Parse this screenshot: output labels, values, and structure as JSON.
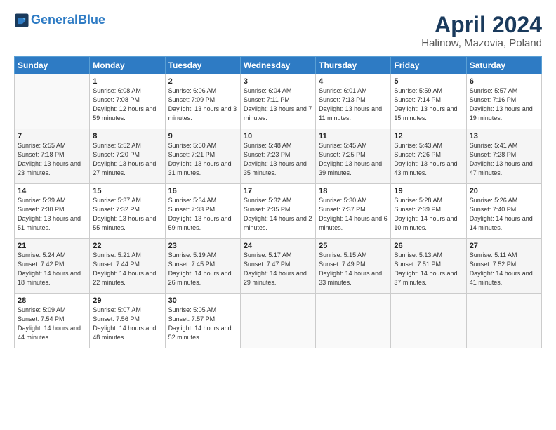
{
  "header": {
    "logo_line1": "General",
    "logo_line2": "Blue",
    "title": "April 2024",
    "subtitle": "Halinow, Mazovia, Poland"
  },
  "weekdays": [
    "Sunday",
    "Monday",
    "Tuesday",
    "Wednesday",
    "Thursday",
    "Friday",
    "Saturday"
  ],
  "weeks": [
    [
      {
        "day": "",
        "sunrise": "",
        "sunset": "",
        "daylight": "",
        "empty": true
      },
      {
        "day": "1",
        "sunrise": "6:08 AM",
        "sunset": "7:08 PM",
        "daylight": "12 hours and 59 minutes."
      },
      {
        "day": "2",
        "sunrise": "6:06 AM",
        "sunset": "7:09 PM",
        "daylight": "13 hours and 3 minutes."
      },
      {
        "day": "3",
        "sunrise": "6:04 AM",
        "sunset": "7:11 PM",
        "daylight": "13 hours and 7 minutes."
      },
      {
        "day": "4",
        "sunrise": "6:01 AM",
        "sunset": "7:13 PM",
        "daylight": "13 hours and 11 minutes."
      },
      {
        "day": "5",
        "sunrise": "5:59 AM",
        "sunset": "7:14 PM",
        "daylight": "13 hours and 15 minutes."
      },
      {
        "day": "6",
        "sunrise": "5:57 AM",
        "sunset": "7:16 PM",
        "daylight": "13 hours and 19 minutes."
      }
    ],
    [
      {
        "day": "7",
        "sunrise": "5:55 AM",
        "sunset": "7:18 PM",
        "daylight": "13 hours and 23 minutes."
      },
      {
        "day": "8",
        "sunrise": "5:52 AM",
        "sunset": "7:20 PM",
        "daylight": "13 hours and 27 minutes."
      },
      {
        "day": "9",
        "sunrise": "5:50 AM",
        "sunset": "7:21 PM",
        "daylight": "13 hours and 31 minutes."
      },
      {
        "day": "10",
        "sunrise": "5:48 AM",
        "sunset": "7:23 PM",
        "daylight": "13 hours and 35 minutes."
      },
      {
        "day": "11",
        "sunrise": "5:45 AM",
        "sunset": "7:25 PM",
        "daylight": "13 hours and 39 minutes."
      },
      {
        "day": "12",
        "sunrise": "5:43 AM",
        "sunset": "7:26 PM",
        "daylight": "13 hours and 43 minutes."
      },
      {
        "day": "13",
        "sunrise": "5:41 AM",
        "sunset": "7:28 PM",
        "daylight": "13 hours and 47 minutes."
      }
    ],
    [
      {
        "day": "14",
        "sunrise": "5:39 AM",
        "sunset": "7:30 PM",
        "daylight": "13 hours and 51 minutes."
      },
      {
        "day": "15",
        "sunrise": "5:37 AM",
        "sunset": "7:32 PM",
        "daylight": "13 hours and 55 minutes."
      },
      {
        "day": "16",
        "sunrise": "5:34 AM",
        "sunset": "7:33 PM",
        "daylight": "13 hours and 59 minutes."
      },
      {
        "day": "17",
        "sunrise": "5:32 AM",
        "sunset": "7:35 PM",
        "daylight": "14 hours and 2 minutes."
      },
      {
        "day": "18",
        "sunrise": "5:30 AM",
        "sunset": "7:37 PM",
        "daylight": "14 hours and 6 minutes."
      },
      {
        "day": "19",
        "sunrise": "5:28 AM",
        "sunset": "7:39 PM",
        "daylight": "14 hours and 10 minutes."
      },
      {
        "day": "20",
        "sunrise": "5:26 AM",
        "sunset": "7:40 PM",
        "daylight": "14 hours and 14 minutes."
      }
    ],
    [
      {
        "day": "21",
        "sunrise": "5:24 AM",
        "sunset": "7:42 PM",
        "daylight": "14 hours and 18 minutes."
      },
      {
        "day": "22",
        "sunrise": "5:21 AM",
        "sunset": "7:44 PM",
        "daylight": "14 hours and 22 minutes."
      },
      {
        "day": "23",
        "sunrise": "5:19 AM",
        "sunset": "7:45 PM",
        "daylight": "14 hours and 26 minutes."
      },
      {
        "day": "24",
        "sunrise": "5:17 AM",
        "sunset": "7:47 PM",
        "daylight": "14 hours and 29 minutes."
      },
      {
        "day": "25",
        "sunrise": "5:15 AM",
        "sunset": "7:49 PM",
        "daylight": "14 hours and 33 minutes."
      },
      {
        "day": "26",
        "sunrise": "5:13 AM",
        "sunset": "7:51 PM",
        "daylight": "14 hours and 37 minutes."
      },
      {
        "day": "27",
        "sunrise": "5:11 AM",
        "sunset": "7:52 PM",
        "daylight": "14 hours and 41 minutes."
      }
    ],
    [
      {
        "day": "28",
        "sunrise": "5:09 AM",
        "sunset": "7:54 PM",
        "daylight": "14 hours and 44 minutes."
      },
      {
        "day": "29",
        "sunrise": "5:07 AM",
        "sunset": "7:56 PM",
        "daylight": "14 hours and 48 minutes."
      },
      {
        "day": "30",
        "sunrise": "5:05 AM",
        "sunset": "7:57 PM",
        "daylight": "14 hours and 52 minutes."
      },
      {
        "day": "",
        "sunrise": "",
        "sunset": "",
        "daylight": "",
        "empty": true
      },
      {
        "day": "",
        "sunrise": "",
        "sunset": "",
        "daylight": "",
        "empty": true
      },
      {
        "day": "",
        "sunrise": "",
        "sunset": "",
        "daylight": "",
        "empty": true
      },
      {
        "day": "",
        "sunrise": "",
        "sunset": "",
        "daylight": "",
        "empty": true
      }
    ]
  ]
}
